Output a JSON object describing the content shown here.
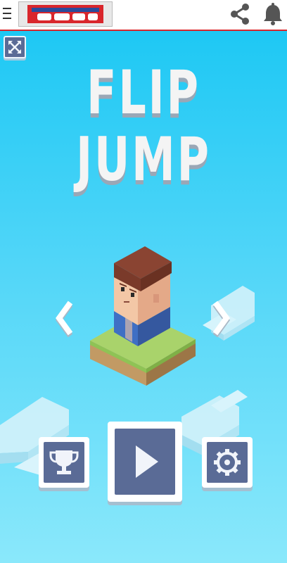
{
  "header": {
    "menu_icon": "menu-icon",
    "share_icon": "share-icon",
    "bell_icon": "bell-icon",
    "banner_colors": {
      "red": "#d9262c",
      "blue": "#2a4b9b"
    }
  },
  "game": {
    "title_line1": "FLIP",
    "title_line2": "JUMP",
    "background_top": "#1ec8f4",
    "background_bottom": "#8ae8fb",
    "buttons": {
      "fullscreen_icon": "expand-icon",
      "previous_icon": "chevron-left-icon",
      "next_icon": "chevron-right-icon",
      "leaderboard_icon": "trophy-icon",
      "play_icon": "play-icon",
      "settings_icon": "gear-icon"
    },
    "character": {
      "hair_color": "#7a3a2a",
      "skin_color": "#f3c7a6",
      "shirt_color": "#3f6fc4",
      "platform_grass": "#a9d36b",
      "platform_dirt": "#b08a5a"
    }
  }
}
